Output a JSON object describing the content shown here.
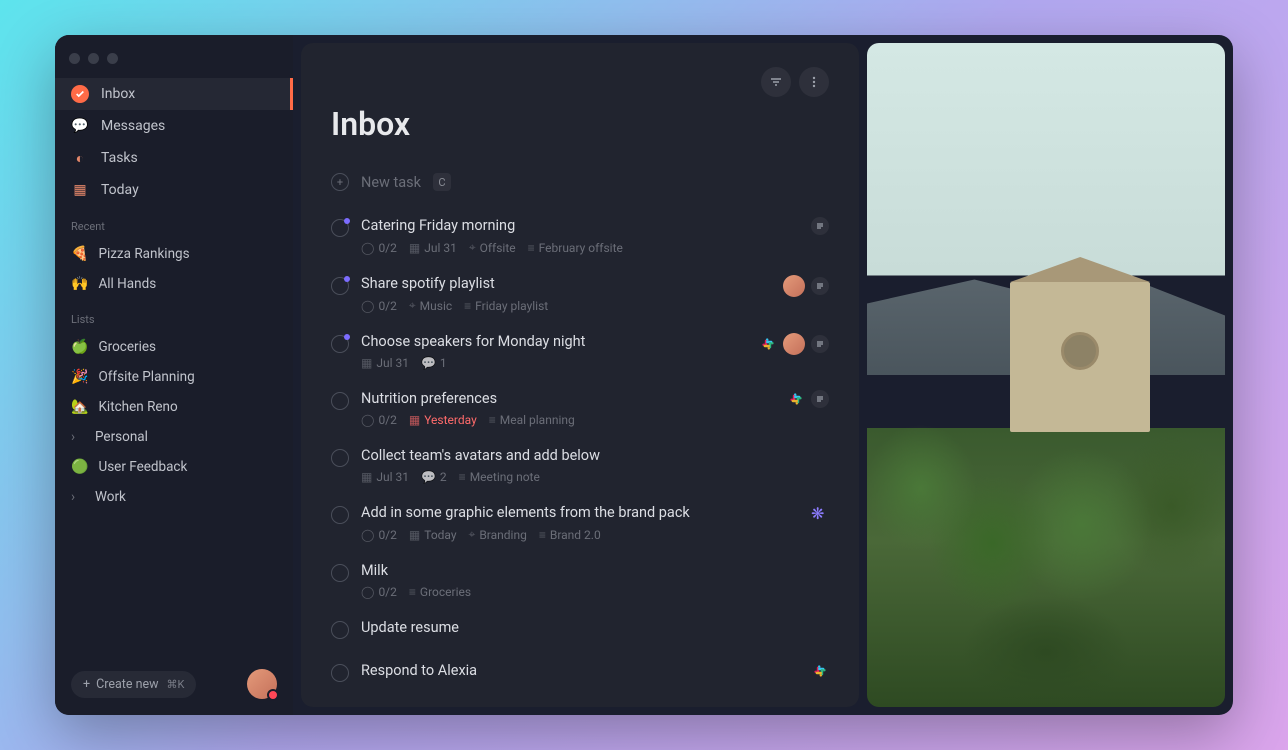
{
  "sidebar": {
    "nav": [
      {
        "label": "Inbox"
      },
      {
        "label": "Messages"
      },
      {
        "label": "Tasks"
      },
      {
        "label": "Today"
      }
    ],
    "recent_label": "Recent",
    "recent": [
      {
        "emoji": "🍕",
        "label": "Pizza Rankings"
      },
      {
        "emoji": "🙌",
        "label": "All Hands"
      }
    ],
    "lists_label": "Lists",
    "lists": [
      {
        "emoji": "🍏",
        "label": "Groceries",
        "chevron": false
      },
      {
        "emoji": "🎉",
        "label": "Offsite Planning",
        "chevron": false
      },
      {
        "emoji": "🏡",
        "label": "Kitchen Reno",
        "chevron": false
      },
      {
        "emoji": "",
        "label": "Personal",
        "chevron": true
      },
      {
        "emoji": "🟢",
        "label": "User Feedback",
        "chevron": false
      },
      {
        "emoji": "",
        "label": "Work",
        "chevron": true
      }
    ],
    "create_label": "Create new",
    "create_kbd": "⌘K"
  },
  "page": {
    "title": "Inbox",
    "new_task_label": "New task",
    "new_task_key": "C"
  },
  "tasks": [
    {
      "title": "Catering Friday morning",
      "dot": true,
      "sub": "0/2",
      "date": "Jul 31",
      "tag": "Offsite",
      "note": "February offsite",
      "lines": true
    },
    {
      "title": "Share spotify playlist",
      "dot": true,
      "sub": "0/2",
      "tag": "Music",
      "note": "Friday playlist",
      "avatar": true,
      "lines": true
    },
    {
      "title": "Choose speakers for Monday night",
      "dot": true,
      "date": "Jul 31",
      "comments": "1",
      "slack": true,
      "avatar": true,
      "lines": true
    },
    {
      "title": "Nutrition preferences",
      "sub": "0/2",
      "date": "Yesterday",
      "date_red": true,
      "note": "Meal planning",
      "slack": true,
      "lines": true
    },
    {
      "title": "Collect team's avatars and add below",
      "date": "Jul 31",
      "comments": "2",
      "note": "Meeting note"
    },
    {
      "title": "Add in some graphic elements from the brand pack",
      "sub": "0/2",
      "date": "Today",
      "tag": "Branding",
      "note": "Brand 2.0",
      "flower": true
    },
    {
      "title": "Milk",
      "sub": "0/2",
      "note": "Groceries"
    },
    {
      "title": "Update resume"
    },
    {
      "title": "Respond to Alexia",
      "slack": true
    }
  ]
}
